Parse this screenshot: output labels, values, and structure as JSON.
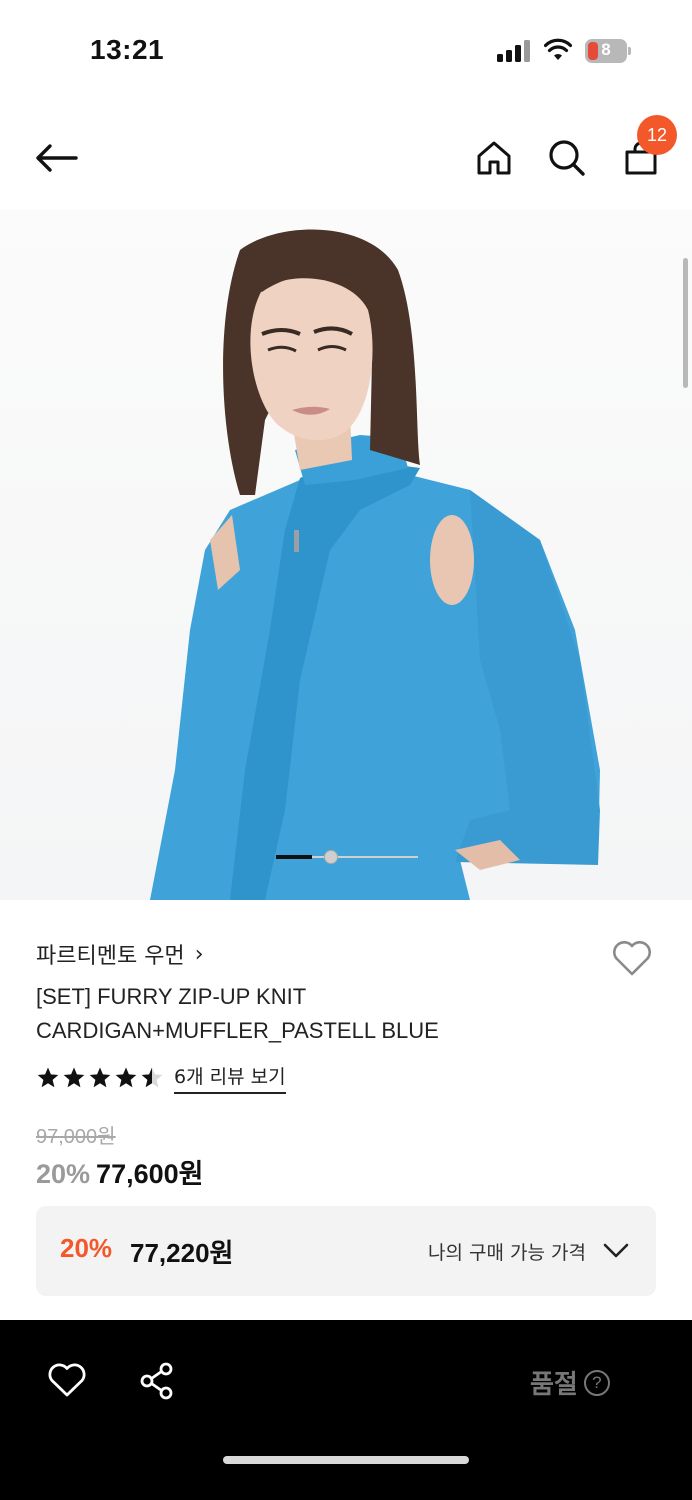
{
  "status_bar": {
    "time": "13:21",
    "battery": "8"
  },
  "header": {
    "cart_count": "12",
    "icons": [
      "back-arrow-icon",
      "home-icon",
      "search-icon",
      "shopping-bag-icon"
    ]
  },
  "product": {
    "brand": "파르티멘토 우먼",
    "brand_chevron": "›",
    "title_line1": "[SET] FURRY ZIP-UP KNIT",
    "title_line2": "CARDIGAN+MUFFLER_PASTELL BLUE",
    "rating": 4.5,
    "review_link": "6개 리뷰 보기",
    "original_price": "97,000원",
    "discount_rate": "20%",
    "sale_price": "77,600원",
    "image_position": {
      "current": 1,
      "total": 4
    }
  },
  "my_price": {
    "discount_rate": "20%",
    "price": "77,220원",
    "label": "나의 구매 가능 가격"
  },
  "bottom_bar": {
    "status_label": "품절",
    "help_symbol": "?"
  },
  "colors": {
    "accent": "#f2582a",
    "bottom_bar_bg": "#000000",
    "price_box_bg": "#f3f3f3",
    "sweater": "#3fa3d9"
  }
}
